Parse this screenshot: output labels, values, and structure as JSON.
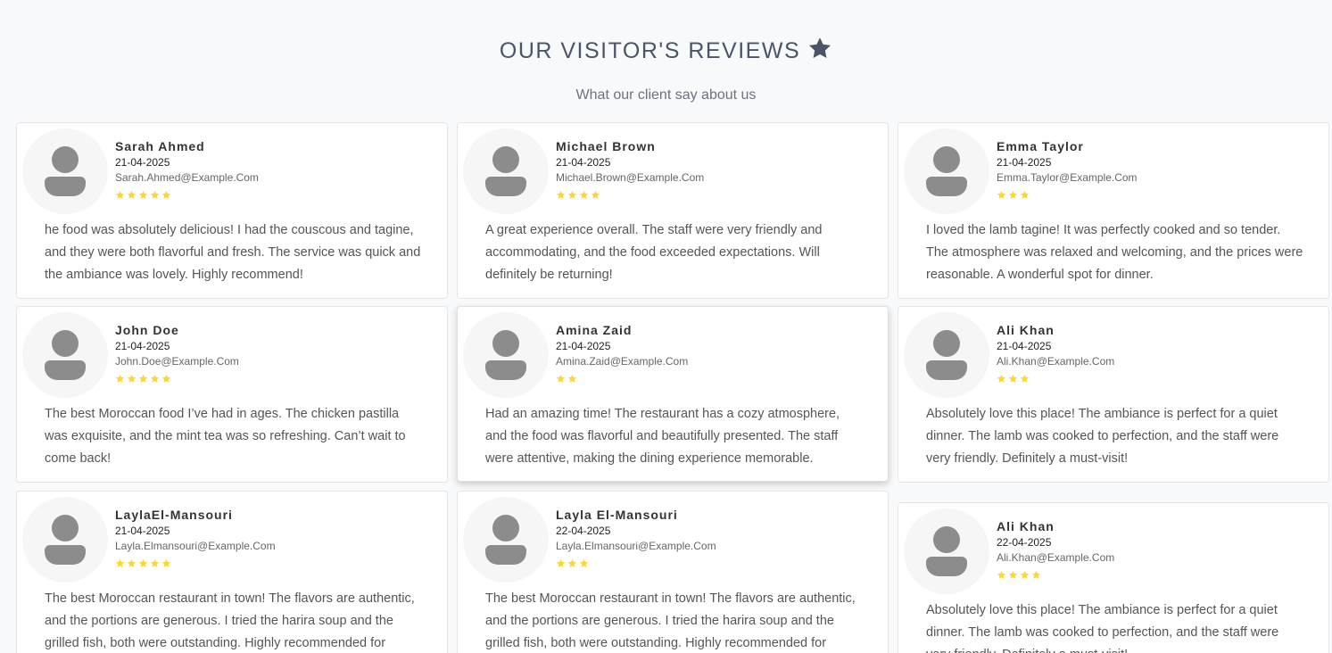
{
  "header": {
    "title": "OUR VISITOR'S REVIEWS",
    "title_icon": "star-icon",
    "subtitle": "What our client say about us"
  },
  "colors": {
    "star": "#fdd835",
    "title_star": "#4a5568",
    "avatar": "#8c8c8c"
  },
  "reviews": [
    {
      "name": "Sarah Ahmed",
      "date": "21-04-2025",
      "email": "Sarah.Ahmed@Example.Com",
      "rating": 5,
      "text": "he food was absolutely delicious! I had the couscous and tagine, and they were both flavorful and fresh. The service was quick and the ambiance was lovely. Highly recommend!"
    },
    {
      "name": "Michael Brown",
      "date": "21-04-2025",
      "email": "Michael.Brown@Example.Com",
      "rating": 4,
      "text": "A great experience overall. The staff were very friendly and accommodating, and the food exceeded expectations. Will definitely be returning!"
    },
    {
      "name": "Emma Taylor",
      "date": "21-04-2025",
      "email": "Emma.Taylor@Example.Com",
      "rating": 3,
      "text": "I loved the lamb tagine! It was perfectly cooked and so tender. The atmosphere was relaxed and welcoming, and the prices were reasonable. A wonderful spot for dinner."
    },
    {
      "name": "John Doe",
      "date": "21-04-2025",
      "email": "John.Doe@Example.Com",
      "rating": 5,
      "text": "The best Moroccan food I’ve had in ages. The chicken pastilla was exquisite, and the mint tea was so refreshing. Can’t wait to come back!"
    },
    {
      "name": "Amina Zaid",
      "date": "21-04-2025",
      "email": "Amina.Zaid@Example.Com",
      "rating": 2,
      "text": "Had an amazing time! The restaurant has a cozy atmosphere, and the food was flavorful and beautifully presented. The staff were attentive, making the dining experience memorable."
    },
    {
      "name": "Ali Khan",
      "date": "21-04-2025",
      "email": "Ali.Khan@Example.Com",
      "rating": 3,
      "text": "Absolutely love this place! The ambiance is perfect for a quiet dinner. The lamb was cooked to perfection, and the staff were very friendly. Definitely a must-visit!"
    },
    {
      "name": "LaylaEl-Mansouri",
      "date": "21-04-2025",
      "email": "Layla.Elmansouri@Example.Com",
      "rating": 5,
      "text": "The best Moroccan restaurant in town! The flavors are authentic, and the portions are generous. I tried the harira soup and the grilled fish, both were outstanding. Highly recommended for anyone"
    },
    {
      "name": "Layla El-Mansouri",
      "date": "22-04-2025",
      "email": "Layla.Elmansouri@Example.Com",
      "rating": 3,
      "text": "The best Moroccan restaurant in town! The flavors are authentic, and the portions are generous. I tried the harira soup and the grilled fish, both were outstanding. Highly recommended for anyone"
    },
    {
      "name": "Ali Khan",
      "date": "22-04-2025",
      "email": "Ali.Khan@Example.Com",
      "rating": 4,
      "text": "Absolutely love this place! The ambiance is perfect for a quiet dinner. The lamb was cooked to perfection, and the staff were very friendly. Definitely a must-visit!"
    }
  ]
}
